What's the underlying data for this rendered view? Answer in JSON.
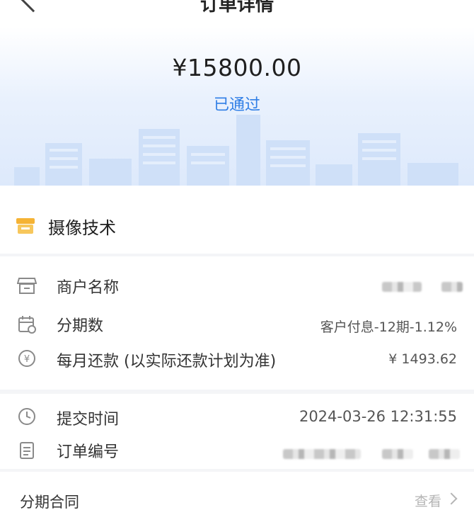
{
  "nav": {
    "title": "订单详情"
  },
  "summary": {
    "amount": "¥15800.00",
    "status": "已通过"
  },
  "merchant": {
    "name": "摄像技术"
  },
  "details": {
    "merchant_name_label": "商户名称",
    "installments_label": "分期数",
    "installments_value": "客户付息-12期-1.12%",
    "monthly_payment_label": "每月还款 (以实际还款计划为准)",
    "monthly_payment_value": "¥ 1493.62"
  },
  "order": {
    "submit_time_label": "提交时间",
    "submit_time_value": "2024-03-26 12:31:55",
    "order_no_label": "订单编号"
  },
  "contract": {
    "label": "分期合同",
    "view_label": "查看"
  },
  "colors": {
    "accent": "#2f7ee6",
    "store_icon": "#f5b335"
  }
}
